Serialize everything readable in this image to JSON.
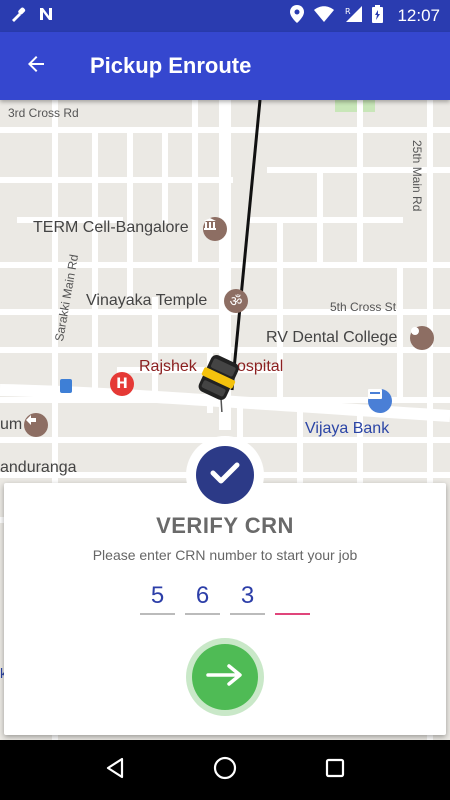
{
  "status_bar": {
    "time": "12:07",
    "icons_left": [
      "eyedropper-icon",
      "notification-n-icon"
    ],
    "icons_right": [
      "location-icon",
      "wifi-icon",
      "signal-roaming-icon",
      "battery-charging-icon"
    ]
  },
  "app_bar": {
    "title": "Pickup Enroute",
    "back_icon": "arrow-left-icon",
    "color": "#3547cf"
  },
  "map": {
    "streets": [
      "3rd Cross Rd",
      "25th Main Rd",
      "Sarakki Main Rd",
      "5th Cross St",
      "Rd"
    ],
    "places": [
      {
        "name": "TERM Cell-Bangalore",
        "icon": "museum-icon"
      },
      {
        "name": "Vinayaka Temple",
        "icon": "om-icon"
      },
      {
        "name": "RV Dental College",
        "icon": "place-dot-icon"
      },
      {
        "name": "Rajshek",
        "suffix": "ospital",
        "icon": "hospital-icon"
      },
      {
        "name": "Vijaya Bank",
        "icon": "atm-icon"
      },
      {
        "name": "um",
        "icon": "direction-icon"
      },
      {
        "name": "anduranga",
        "icon": null
      },
      {
        "name": "k",
        "icon": null
      }
    ]
  },
  "verify": {
    "title": "VERIFY CRN",
    "subtitle": "Please enter CRN number to start your job",
    "digits": [
      "5",
      "6",
      "3",
      ""
    ],
    "submit_icon": "arrow-right-icon",
    "check_color": "#2c3a87",
    "submit_color": "#4fbb55"
  },
  "nav_bar": {
    "back_icon": "triangle-back-icon",
    "home_icon": "circle-home-icon",
    "recent_icon": "square-recent-icon"
  }
}
